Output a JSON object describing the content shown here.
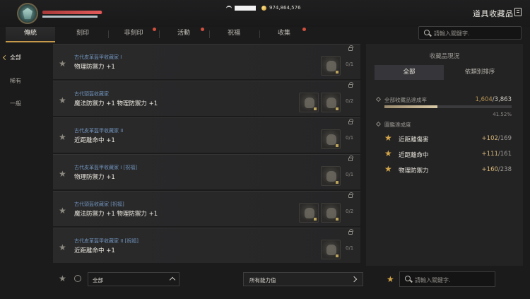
{
  "header": {
    "currency_amount": "974,864,576",
    "page_title": "道具收藏品"
  },
  "tabs": [
    {
      "label": "傳統"
    },
    {
      "label": "刻印"
    },
    {
      "label": "非刻印"
    },
    {
      "label": "活動"
    },
    {
      "label": "祝福"
    },
    {
      "label": "收集"
    }
  ],
  "search": {
    "placeholder": "請輸入關鍵字."
  },
  "sidebar": {
    "items": [
      {
        "label": "全部"
      },
      {
        "label": "稀有"
      },
      {
        "label": "一般"
      }
    ]
  },
  "collections": [
    {
      "category": "古代皮革盔甲收藏家 I",
      "effect": "物理防禦力 +1",
      "progress": "0/1"
    },
    {
      "category": "古代頭盔收藏家",
      "effect": "魔法防禦力 +1 物理防禦力 +1",
      "progress": "0/2"
    },
    {
      "category": "古代皮革盔甲收藏家 II",
      "effect": "近距離命中 +1",
      "progress": "0/1"
    },
    {
      "category": "古代皮革盔甲收藏家 I [祝福]",
      "effect": "物理防禦力 +1",
      "progress": "0/1"
    },
    {
      "category": "古代頭盔收藏家 [祝福]",
      "effect": "魔法防禦力 +1 物理防禦力 +1",
      "progress": "0/2"
    },
    {
      "category": "古代皮革盔甲收藏家 II [祝福]",
      "effect": "近距離命中 +1",
      "progress": "0/1"
    }
  ],
  "bottom_bar": {
    "dropdown_value": "全部",
    "filter_label": "所有能力值"
  },
  "panel": {
    "title": "收藏品現況",
    "tabs": [
      {
        "label": "全部"
      },
      {
        "label": "依類別排序"
      }
    ],
    "completion_label": "全部收藏品達成率",
    "completion_value": "1,604",
    "completion_total": "/3,863",
    "completion_fraction": 0.4152,
    "completion_percent": "41.52%",
    "codex_label": "圖鑑達成度",
    "stats": [
      {
        "label": "近距離傷害",
        "value": "+102",
        "total": "/169"
      },
      {
        "label": "近距離命中",
        "value": "+111",
        "total": "/161"
      },
      {
        "label": "物理防禦力",
        "value": "+160",
        "total": "/238"
      }
    ]
  },
  "right_search": {
    "placeholder": "請輸入關鍵字."
  },
  "colors": {
    "accent_gold": "#c49a4a",
    "notification_dot": "#d0503e",
    "category_blue": "#6e90b8"
  }
}
